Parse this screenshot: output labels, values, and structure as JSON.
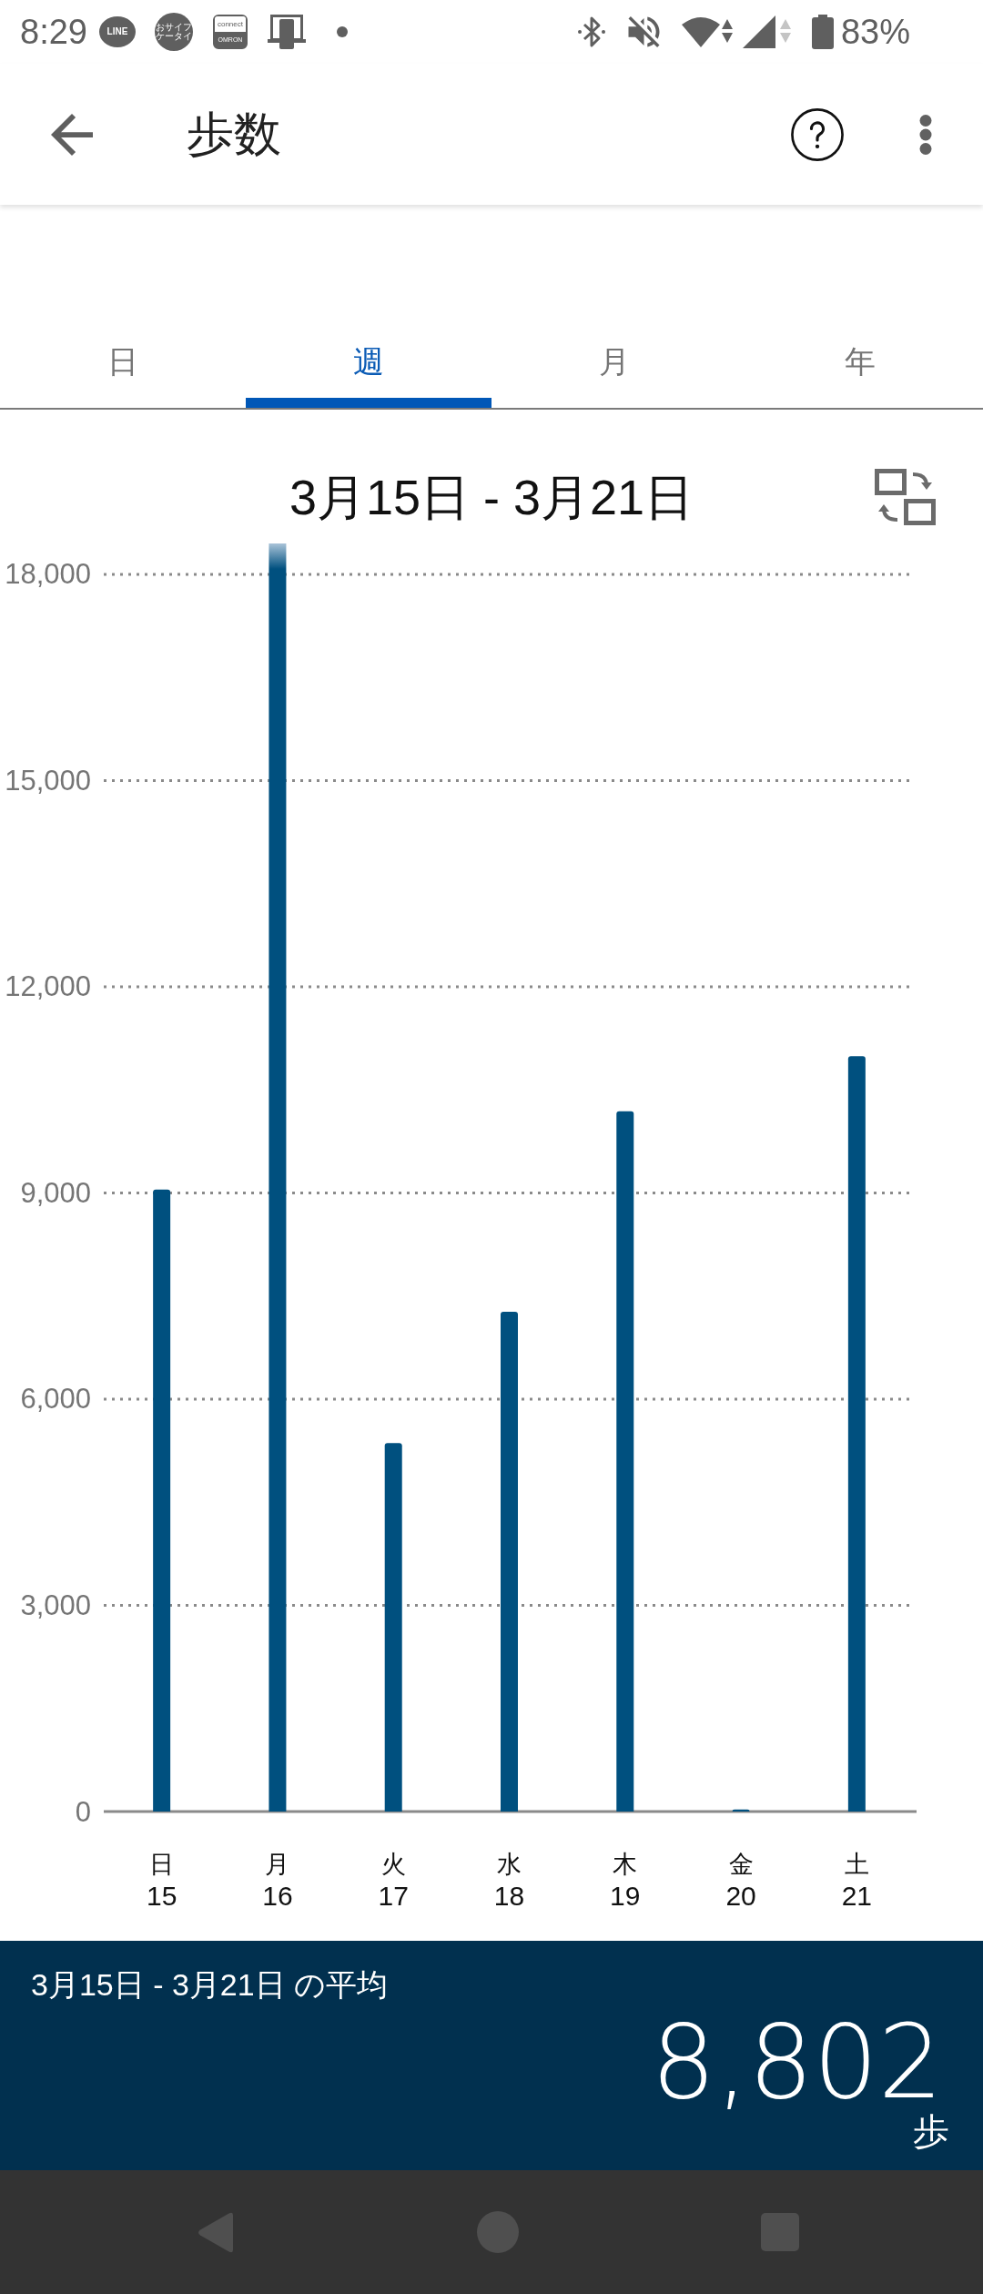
{
  "status_bar": {
    "time": "8:29",
    "notifications": [
      {
        "kind": "chat",
        "text": "LINE"
      },
      {
        "kind": "wallet",
        "text": "おサイフケータイ"
      },
      {
        "kind": "connect",
        "text": "connect",
        "subtext": "OMRON"
      },
      {
        "kind": "device"
      },
      {
        "kind": "more"
      }
    ],
    "battery": "83%"
  },
  "app_bar": {
    "title": "歩数"
  },
  "tabs": [
    {
      "label": "日",
      "selected": false
    },
    {
      "label": "週",
      "selected": true
    },
    {
      "label": "月",
      "selected": false
    },
    {
      "label": "年",
      "selected": false
    }
  ],
  "chart": {
    "chart_data": {
      "type": "bar",
      "title": "3月15日 - 3月21日",
      "categories": [
        "日\n15",
        "月\n16",
        "火\n17",
        "水\n18",
        "木\n19",
        "金\n20",
        "土\n21"
      ],
      "values": [
        9050,
        18450,
        5360,
        7270,
        10190,
        30,
        10990
      ],
      "ylim": [
        0,
        18450
      ],
      "yticks": [
        {
          "value": 0,
          "label": "0"
        },
        {
          "value": 3000,
          "label": "3,000"
        },
        {
          "value": 6000,
          "label": "6,000"
        },
        {
          "value": 9000,
          "label": "9,000"
        },
        {
          "value": 12000,
          "label": "12,000"
        },
        {
          "value": 15000,
          "label": "15,000"
        },
        {
          "value": 18000,
          "label": "18,000"
        }
      ],
      "grid": true
    }
  },
  "summary": {
    "label": "3月15日 - 3月21日 の平均",
    "value": "8,802",
    "unit": "歩"
  }
}
